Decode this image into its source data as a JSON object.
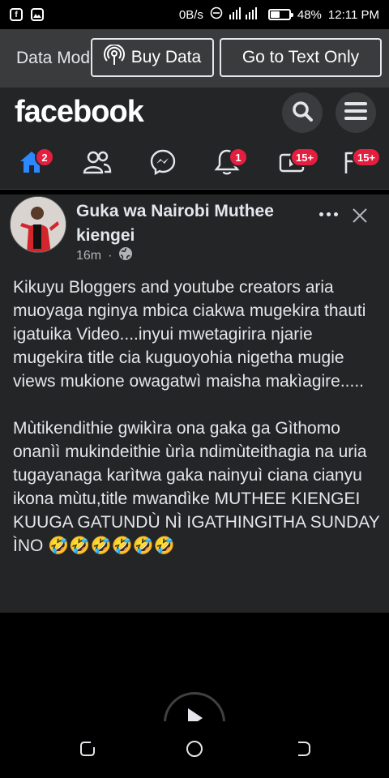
{
  "status_bar": {
    "left_icons": [
      "facebook-icon",
      "image-icon"
    ],
    "speed": "0B/s",
    "battery": "48%",
    "battery_level": 0.48,
    "time": "12:11 PM"
  },
  "banner": {
    "text": "Data Mode",
    "buy_data_label": "Buy Data",
    "text_only_label": "Go to Text Only"
  },
  "header": {
    "logo": "facebook",
    "search_icon": "search-icon",
    "menu_icon": "menu-icon"
  },
  "nav": {
    "items": [
      {
        "name": "home",
        "icon": "home-icon",
        "badge": "2",
        "active": true
      },
      {
        "name": "friends",
        "icon": "friends-icon",
        "badge": ""
      },
      {
        "name": "messenger",
        "icon": "messenger-icon",
        "badge": ""
      },
      {
        "name": "notifications",
        "icon": "bell-icon",
        "badge": "1"
      },
      {
        "name": "watch",
        "icon": "video-icon",
        "badge": "15+"
      },
      {
        "name": "marketplace",
        "icon": "flag-icon",
        "badge": "15+"
      }
    ]
  },
  "post": {
    "author": "Guka wa Nairobi Muthee kiengei",
    "time": "16m",
    "separator": "·",
    "privacy_icon": "globe-icon",
    "paragraph_1": "Kikuyu Bloggers and youtube creators aria muoyaga nginya mbica ciakwa mugekira thauti igatuika Video....inyui mwetagirira njarie mugekira title cia kuguoyohia nigetha mugie views mukione owagatwì maisha makìagire.....",
    "paragraph_2": "Mùtikendithie gwikìra ona gaka ga Gìthomo onanìì mukindeithie ùrìa ndimùteithagia na uria tugayanaga karìtwa gaka nainyuì ciana cianyu ikona mùtu,title mwandìke MUTHEE KIENGEI KUUGA GATUNDÙ NÌ IGATHINGITHA SUNDAY ÌNO 🤣🤣🤣🤣🤣🤣"
  },
  "colors": {
    "background": "#242526",
    "banner": "#3a3b3c",
    "accent": "#2d88ff",
    "badge": "#e41e3f",
    "text": "#e4e6eb"
  }
}
